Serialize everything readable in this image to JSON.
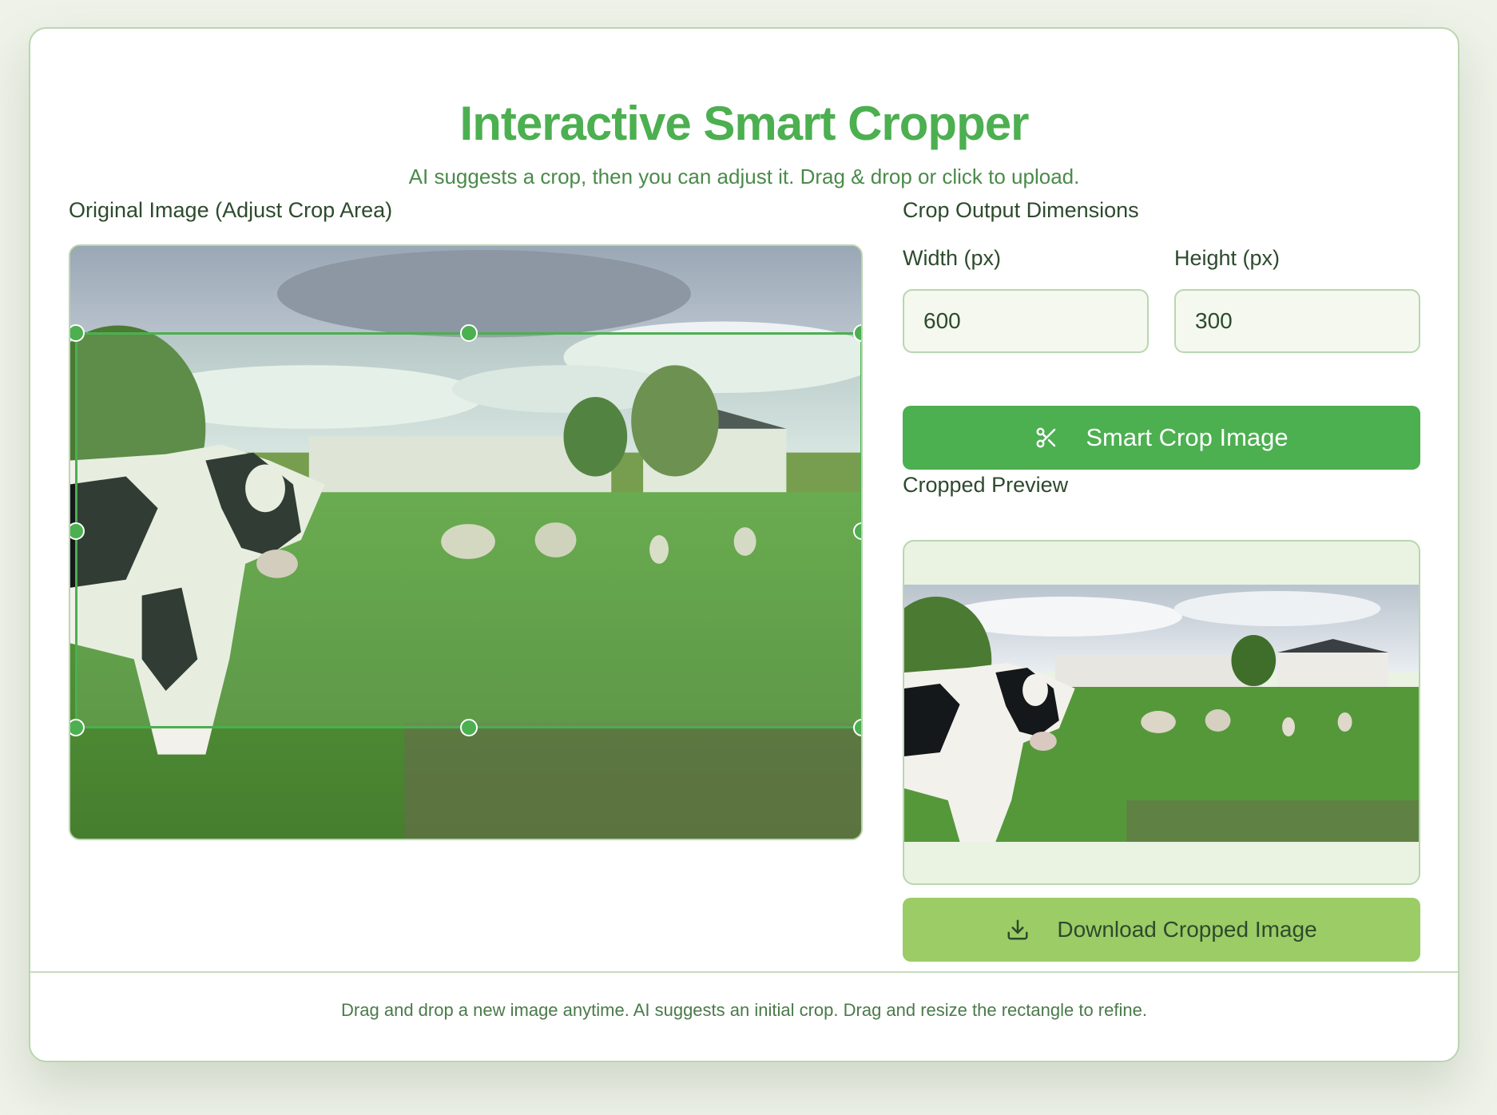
{
  "header": {
    "title": "Interactive Smart Cropper",
    "subtitle": "AI suggests a crop, then you can adjust it. Drag & drop or click to upload."
  },
  "original": {
    "label": "Original Image (Adjust Crop Area)"
  },
  "controls": {
    "section_label": "Crop Output Dimensions",
    "width_label": "Width (px)",
    "height_label": "Height (px)",
    "width_value": "600",
    "height_value": "300",
    "smart_crop_label": "Smart Crop Image",
    "smart_crop_icon": "scissors-icon"
  },
  "preview": {
    "label": "Cropped Preview"
  },
  "download": {
    "label": "Download Cropped Image",
    "icon": "download-icon"
  },
  "footer": {
    "text": "Drag and drop a new image anytime. AI suggests an initial crop. Drag and resize the rectangle to refine."
  },
  "colors": {
    "accent": "#4caf50",
    "accent_light": "#9ccc65",
    "text_dark": "#2d4a2d",
    "border": "#b9d6b0"
  }
}
